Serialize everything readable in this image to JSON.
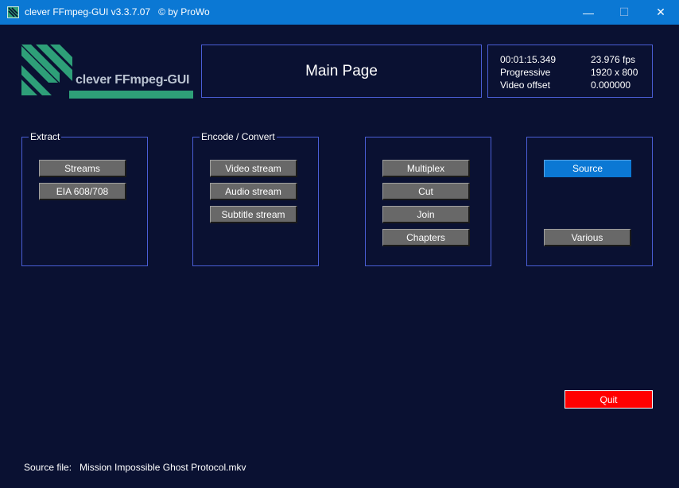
{
  "window": {
    "title": "clever FFmpeg-GUI v3.3.7.07",
    "copyright": "© by ProWo",
    "icon": "ffmpeg-logo-icon",
    "controls": {
      "minimize": "—",
      "maximize": "☐",
      "close": "✕"
    }
  },
  "logo": {
    "text": "clever FFmpeg-GUI",
    "color": "#2e9f78"
  },
  "page": {
    "title": "Main Page"
  },
  "media_info": {
    "duration": "00:01:15.349",
    "fps": "23.976 fps",
    "scan": "Progressive",
    "resolution": "1920 x 800",
    "offset_label": "Video offset",
    "offset_value": "0.000000"
  },
  "groups": {
    "extract": {
      "label": "Extract",
      "buttons": [
        "Streams",
        "EIA 608/708"
      ]
    },
    "encode": {
      "label": "Encode / Convert",
      "buttons": [
        "Video stream",
        "Audio stream",
        "Subtitle stream"
      ]
    },
    "mux": {
      "buttons": [
        "Multiplex",
        "Cut",
        "Join",
        "Chapters"
      ]
    },
    "nav": {
      "buttons": [
        "Source",
        "Various"
      ]
    }
  },
  "quit": {
    "label": "Quit"
  },
  "source_file": {
    "label": "Source file:",
    "value": "Mission Impossible Ghost Protocol.mkv"
  },
  "colors": {
    "background": "#0a1132",
    "titlebar": "#0b78d4",
    "border": "#4a5ed6",
    "button": "#686868",
    "active_button": "#0b78d4",
    "quit_button": "#ff0000"
  }
}
